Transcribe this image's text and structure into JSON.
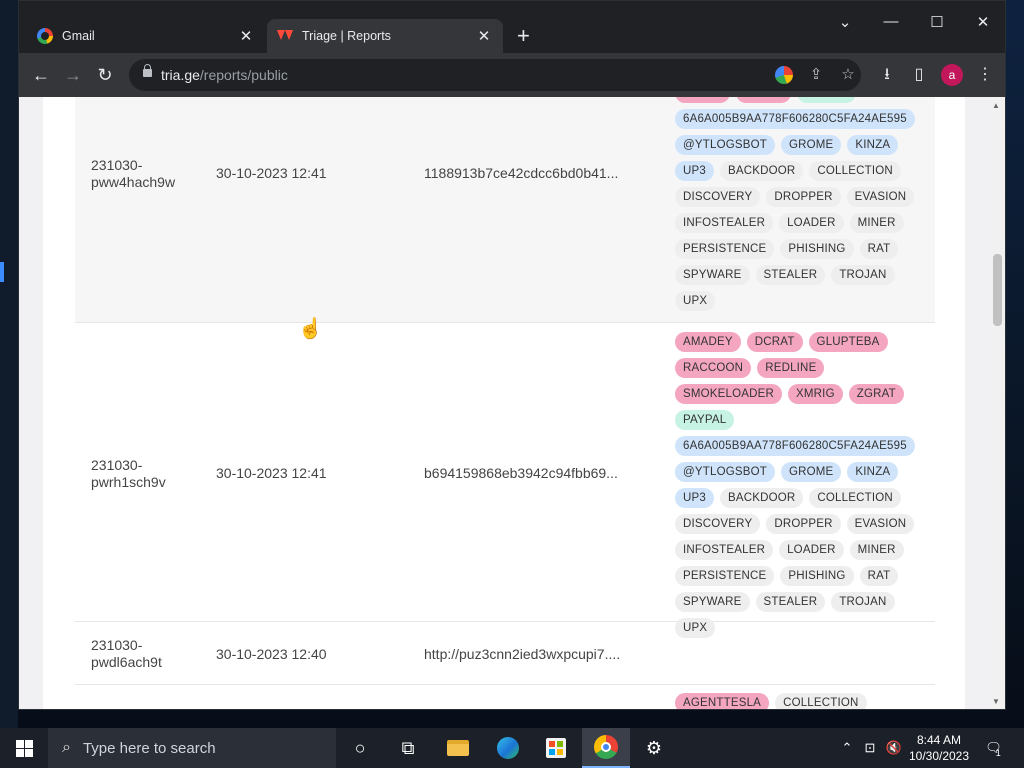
{
  "browser": {
    "tabs": [
      {
        "title": "Gmail",
        "icon": "gmail-google-icon",
        "active": false
      },
      {
        "title": "Triage | Reports",
        "icon": "triage-icon",
        "active": true
      }
    ],
    "new_tab": "+",
    "window_controls": {
      "minimize": "—",
      "maximize": "☐",
      "close": "✕",
      "tab_search": "⌄"
    },
    "url_host": "tria.ge",
    "url_path": "/reports/public",
    "profile_initial": "a"
  },
  "reports": [
    {
      "id": "231030-pww4hach9w",
      "id_line1": "231030-",
      "id_line2": "pww4hach9w",
      "date": "30-10-2023 12:41",
      "target": "1188913b7ce42cdcc6bd0b41...",
      "highlighted": true,
      "tags": [
        {
          "label": "XMRIG",
          "color": "pink"
        },
        {
          "label": "ZGRAT",
          "color": "pink"
        },
        {
          "label": "PAYPAL",
          "color": "green"
        },
        {
          "label": "6A6A005B9AA778F606280C5FA24AE595",
          "color": "blue"
        },
        {
          "label": "@YTLOGSBOT",
          "color": "blue"
        },
        {
          "label": "GROME",
          "color": "blue"
        },
        {
          "label": "KINZA",
          "color": "blue"
        },
        {
          "label": "UP3",
          "color": "blue"
        },
        {
          "label": "BACKDOOR",
          "color": "gray"
        },
        {
          "label": "COLLECTION",
          "color": "gray"
        },
        {
          "label": "DISCOVERY",
          "color": "gray"
        },
        {
          "label": "DROPPER",
          "color": "gray"
        },
        {
          "label": "EVASION",
          "color": "gray"
        },
        {
          "label": "INFOSTEALER",
          "color": "gray"
        },
        {
          "label": "LOADER",
          "color": "gray"
        },
        {
          "label": "MINER",
          "color": "gray"
        },
        {
          "label": "PERSISTENCE",
          "color": "gray"
        },
        {
          "label": "PHISHING",
          "color": "gray"
        },
        {
          "label": "RAT",
          "color": "gray"
        },
        {
          "label": "SPYWARE",
          "color": "gray"
        },
        {
          "label": "STEALER",
          "color": "gray"
        },
        {
          "label": "TROJAN",
          "color": "gray"
        },
        {
          "label": "UPX",
          "color": "gray"
        }
      ]
    },
    {
      "id": "231030-pwrh1sch9v",
      "id_line1": "231030-",
      "id_line2": "pwrh1sch9v",
      "date": "30-10-2023 12:41",
      "target": "b694159868eb3942c94fbb69...",
      "highlighted": false,
      "tags": [
        {
          "label": "AMADEY",
          "color": "pink"
        },
        {
          "label": "DCRAT",
          "color": "pink"
        },
        {
          "label": "GLUPTEBA",
          "color": "pink"
        },
        {
          "label": "RACCOON",
          "color": "pink"
        },
        {
          "label": "REDLINE",
          "color": "pink"
        },
        {
          "label": "SMOKELOADER",
          "color": "pink"
        },
        {
          "label": "XMRIG",
          "color": "pink"
        },
        {
          "label": "ZGRAT",
          "color": "pink"
        },
        {
          "label": "PAYPAL",
          "color": "green"
        },
        {
          "label": "6A6A005B9AA778F606280C5FA24AE595",
          "color": "blue"
        },
        {
          "label": "@YTLOGSBOT",
          "color": "blue"
        },
        {
          "label": "GROME",
          "color": "blue"
        },
        {
          "label": "KINZA",
          "color": "blue"
        },
        {
          "label": "UP3",
          "color": "blue"
        },
        {
          "label": "BACKDOOR",
          "color": "gray"
        },
        {
          "label": "COLLECTION",
          "color": "gray"
        },
        {
          "label": "DISCOVERY",
          "color": "gray"
        },
        {
          "label": "DROPPER",
          "color": "gray"
        },
        {
          "label": "EVASION",
          "color": "gray"
        },
        {
          "label": "INFOSTEALER",
          "color": "gray"
        },
        {
          "label": "LOADER",
          "color": "gray"
        },
        {
          "label": "MINER",
          "color": "gray"
        },
        {
          "label": "PERSISTENCE",
          "color": "gray"
        },
        {
          "label": "PHISHING",
          "color": "gray"
        },
        {
          "label": "RAT",
          "color": "gray"
        },
        {
          "label": "SPYWARE",
          "color": "gray"
        },
        {
          "label": "STEALER",
          "color": "gray"
        },
        {
          "label": "TROJAN",
          "color": "gray"
        },
        {
          "label": "UPX",
          "color": "gray"
        }
      ]
    },
    {
      "id": "231030-pwdl6ach9t",
      "id_line1": "231030-",
      "id_line2": "pwdl6ach9t",
      "date": "30-10-2023 12:40",
      "target": "http://puz3cnn2ied3wxpcupi7....",
      "highlighted": false,
      "tags": []
    },
    {
      "id": "",
      "id_line1": "",
      "id_line2": "",
      "date": "",
      "target": "",
      "highlighted": false,
      "tags": [
        {
          "label": "AGENTTESLA",
          "color": "pink"
        },
        {
          "label": "COLLECTION",
          "color": "gray"
        }
      ]
    }
  ],
  "taskbar": {
    "search_placeholder": "Type here to search",
    "apps": [
      "task-view",
      "file-explorer",
      "edge",
      "microsoft-store",
      "chrome",
      "settings"
    ],
    "active_app": "chrome",
    "time": "8:44 AM",
    "date": "10/30/2023",
    "notification_count": "1"
  },
  "colors": {
    "tag_pink": "#f4a6c0",
    "tag_green": "#c7f3e4",
    "tag_blue": "#cfe4fb",
    "tag_gray": "#eeeeee"
  }
}
